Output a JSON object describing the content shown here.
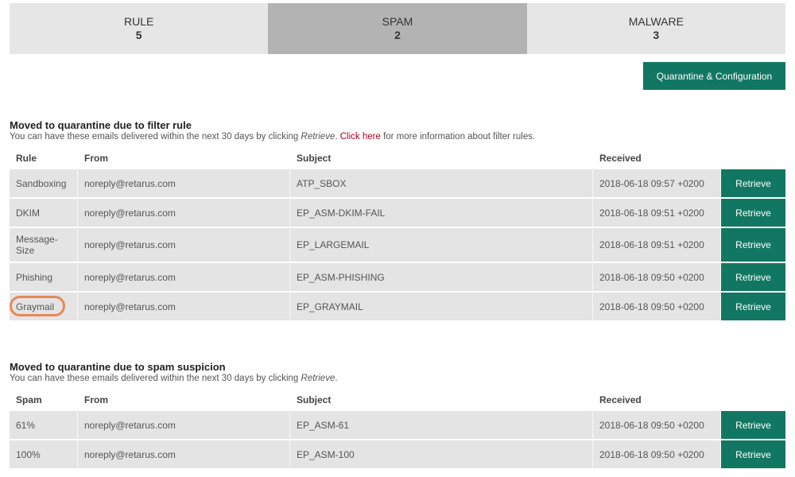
{
  "tabs": [
    {
      "label": "RULE",
      "count": "5"
    },
    {
      "label": "SPAM",
      "count": "2"
    },
    {
      "label": "MALWARE",
      "count": "3"
    }
  ],
  "config_button": "Quarantine & Configuration",
  "rule_section": {
    "title": "Moved to quarantine due to filter rule",
    "desc_prefix": "You can have these emails delivered within the next 30 days by clicking ",
    "desc_action": "Retrieve",
    "desc_mid": ". ",
    "desc_link": "Click here",
    "desc_suffix": " for more information about filter rules.",
    "headers": [
      "Rule",
      "From",
      "Subject",
      "Received"
    ],
    "rows": [
      {
        "rule": "Sandboxing",
        "from": "noreply@retarus.com",
        "subject": "ATP_SBOX",
        "received": "2018-06-18 09:57 +0200",
        "action": "Retrieve"
      },
      {
        "rule": "DKIM",
        "from": "noreply@retarus.com",
        "subject": "EP_ASM-DKIM-FAIL",
        "received": "2018-06-18 09:51 +0200",
        "action": "Retrieve"
      },
      {
        "rule": "Message-Size",
        "from": "noreply@retarus.com",
        "subject": "EP_LARGEMAIL",
        "received": "2018-06-18 09:51 +0200",
        "action": "Retrieve"
      },
      {
        "rule": "Phishing",
        "from": "noreply@retarus.com",
        "subject": "EP_ASM-PHISHING",
        "received": "2018-06-18 09:50 +0200",
        "action": "Retrieve"
      },
      {
        "rule": "Graymail",
        "from": "noreply@retarus.com",
        "subject": "EP_GRAYMAIL",
        "received": "2018-06-18 09:50 +0200",
        "action": "Retrieve"
      }
    ]
  },
  "spam_section": {
    "title": "Moved to quarantine due to spam suspicion",
    "desc_prefix": "You can have these emails delivered within the next 30 days by clicking ",
    "desc_action": "Retrieve",
    "desc_suffix": ".",
    "headers": [
      "Spam",
      "From",
      "Subject",
      "Received"
    ],
    "rows": [
      {
        "spam": "61%",
        "from": "noreply@retarus.com",
        "subject": "EP_ASM-61",
        "received": "2018-06-18 09:50 +0200",
        "action": "Retrieve"
      },
      {
        "spam": "100%",
        "from": "noreply@retarus.com",
        "subject": "EP_ASM-100",
        "received": "2018-06-18 09:50 +0200",
        "action": "Retrieve"
      }
    ]
  },
  "colors": {
    "accent": "#127762",
    "highlight": "#e8875a",
    "link": "#b00020"
  }
}
